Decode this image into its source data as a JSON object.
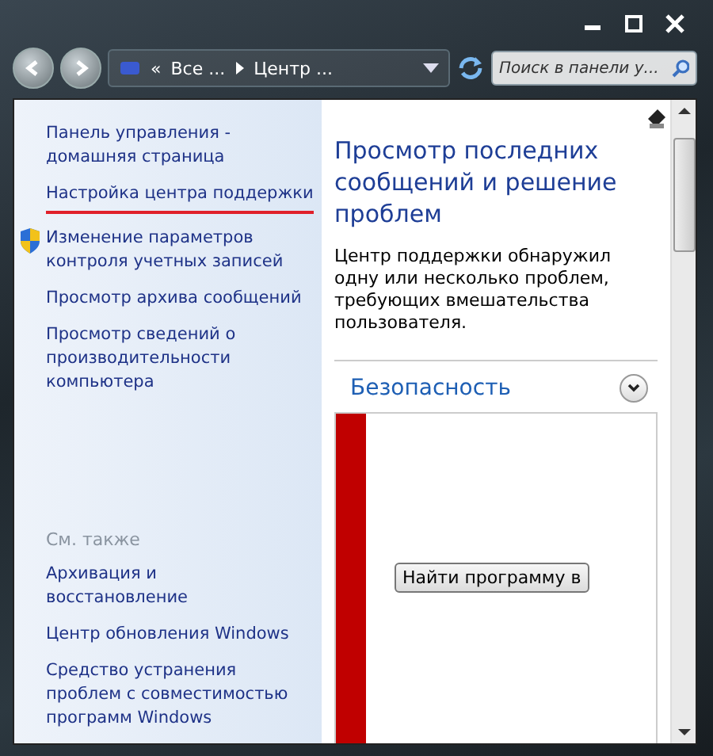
{
  "address_bar": {
    "overflow": "«",
    "crumbs": [
      "Все ...",
      "Центр ..."
    ]
  },
  "search": {
    "placeholder": "Поиск в панели у..."
  },
  "sidebar": {
    "items": [
      {
        "label": "Панель управления - домашняя страница",
        "kind": "link",
        "highlighted": false
      },
      {
        "label": "Настройка центра поддержки",
        "kind": "link",
        "highlighted": true
      },
      {
        "label": "Изменение параметров контроля учетных записей",
        "kind": "shield",
        "highlighted": false
      },
      {
        "label": "Просмотр архива сообщений",
        "kind": "link",
        "highlighted": false
      },
      {
        "label": "Просмотр сведений о производительности компьютера",
        "kind": "link",
        "highlighted": false
      }
    ],
    "see_also": {
      "heading": "См. также",
      "items": [
        "Архивация и восстановление",
        "Центр обновления Windows",
        "Средство устранения проблем с совместимостью программ Windows"
      ]
    }
  },
  "main": {
    "title": "Просмотр последних сообщений и решение проблем",
    "description": "Центр поддержки обнаружил одну или несколько проблем, требующих вмешательства пользователя.",
    "section": {
      "title": "Безопасность",
      "alert": {
        "color": "#c00000",
        "button": "Найти программу в"
      }
    }
  }
}
